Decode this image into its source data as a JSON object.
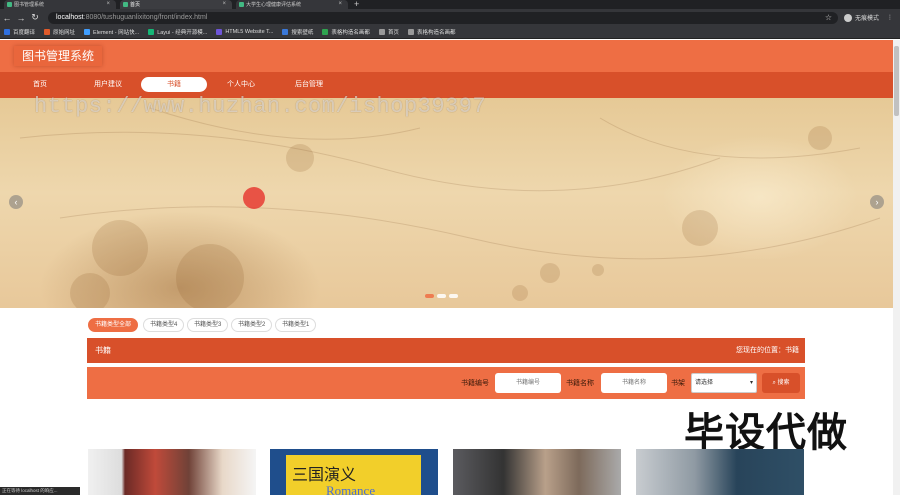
{
  "browser": {
    "tabs": [
      {
        "label": "图书管理系统"
      },
      {
        "label": "首页"
      },
      {
        "label": "大学生心理健康评估系统"
      }
    ],
    "new_tab": "+",
    "url_host": "localhost",
    "url_path": ":8080/tushuguanlixitong/front/index.html",
    "profile": "无痕模式",
    "bookmarks": [
      {
        "label": "百度翻译",
        "color": "#2f6fde"
      },
      {
        "label": "原始网址",
        "color": "#e05a2a"
      },
      {
        "label": "Element - 网站快...",
        "color": "#409eff"
      },
      {
        "label": "Layui - 经典开源模...",
        "color": "#16b777"
      },
      {
        "label": "HTML5 Website T...",
        "color": "#6e55d8"
      },
      {
        "label": "搜索壁纸",
        "color": "#3a78d8"
      },
      {
        "label": "表格构造名画都",
        "color": "#2fa34f"
      },
      {
        "label": "首页",
        "color": "#999999"
      },
      {
        "label": "表格构造名画都",
        "color": "#999999"
      }
    ]
  },
  "site": {
    "logo": "图书管理系统",
    "nav": [
      "首页",
      "用户建议",
      "书籍",
      "个人中心",
      "后台管理"
    ],
    "active_nav": "书籍",
    "watermark": "https://www.huzhan.com/ishop39397",
    "slider_prev": "‹",
    "slider_next": "›",
    "categories": [
      "书籍类型全部",
      "书籍类型4",
      "书籍类型3",
      "书籍类型2",
      "书籍类型1"
    ],
    "title": "书籍",
    "location_label": "您现在的位置：书籍",
    "search": {
      "label_code": "书籍编号",
      "placeholder_code": "书籍编号",
      "label_name": "书籍名称",
      "placeholder_name": "书籍名称",
      "label_type": "书架",
      "select_value": "请选择",
      "button": "搜索"
    },
    "promo": "毕设代做",
    "book2_cn": "三国演义",
    "book2_en": "Romance"
  },
  "statusbar": "正在等待 localhost 的响应...",
  "colors": {
    "primary": "#ee6e44",
    "dark": "#d8502a"
  }
}
